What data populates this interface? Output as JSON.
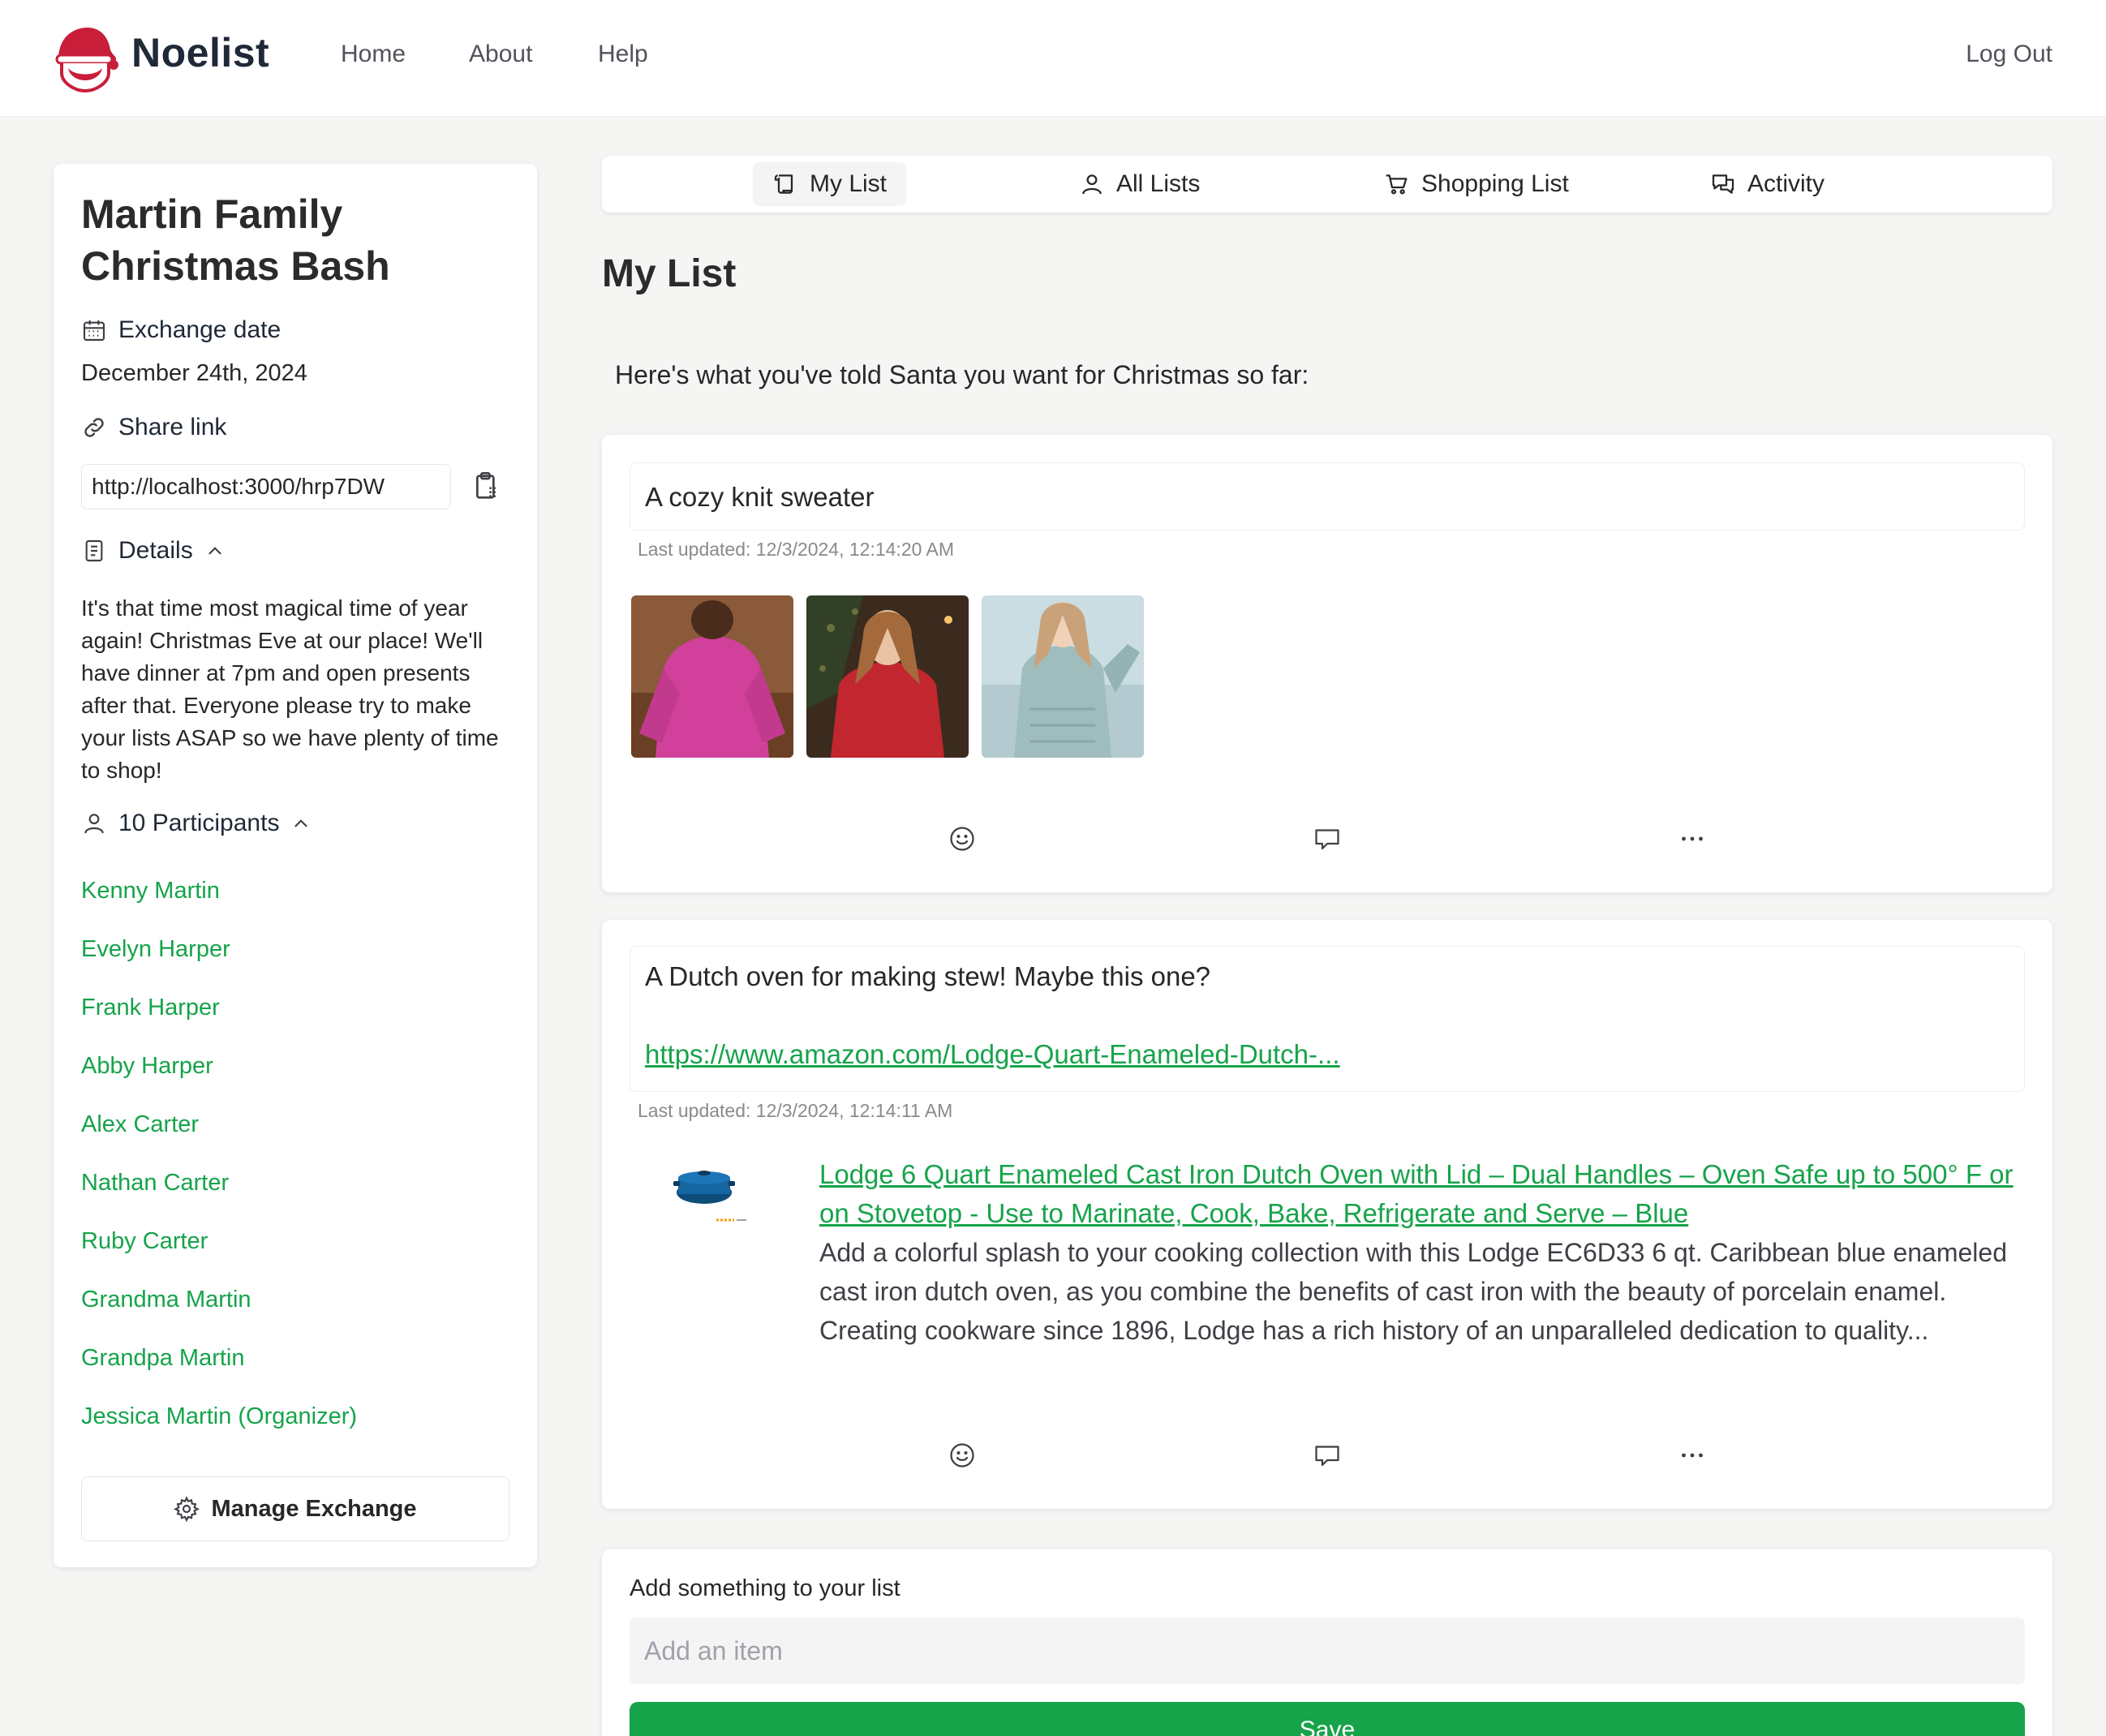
{
  "header": {
    "brand": "Noelist",
    "nav": [
      "Home",
      "About",
      "Help"
    ],
    "logout": "Log Out"
  },
  "sidebar": {
    "title": "Martin Family Christmas Bash",
    "exchange_date_label": "Exchange date",
    "exchange_date": "December 24th, 2024",
    "share_link_label": "Share link",
    "share_link": "http://localhost:3000/hrp7DW",
    "details_label": "Details",
    "details": "It's that time most magical time of year again! Christmas Eve at our place! We'll have dinner at 7pm and open presents after that. Everyone please try to make your lists ASAP so we have plenty of time to shop!",
    "participants_label": "10 Participants",
    "participants": [
      "Kenny Martin",
      "Evelyn Harper",
      "Frank Harper",
      "Abby Harper",
      "Alex Carter",
      "Nathan Carter",
      "Ruby Carter",
      "Grandma Martin",
      "Grandpa Martin",
      "Jessica Martin (Organizer)"
    ],
    "manage_button": "Manage Exchange"
  },
  "tabs": [
    "My List",
    "All Lists",
    "Shopping List",
    "Activity"
  ],
  "main": {
    "title": "My List",
    "intro": "Here's what you've told Santa you want for Christmas so far:",
    "items": [
      {
        "text": "A cozy knit sweater",
        "updated": "Last updated: 12/3/2024, 12:14:20 AM"
      },
      {
        "text": "A Dutch oven for making stew! Maybe this one?",
        "link": "https://www.amazon.com/Lodge-Quart-Enameled-Dutch-...",
        "updated": "Last updated: 12/3/2024, 12:14:11 AM",
        "preview_title": "Lodge 6 Quart Enameled Cast Iron Dutch Oven with Lid – Dual Handles – Oven Safe up to 500° F or on Stovetop - Use to Marinate, Cook, Bake, Refrigerate and Serve – Blue",
        "preview_desc": "Add a colorful splash to your cooking collection with this Lodge EC6D33 6 qt. Caribbean blue enameled cast iron dutch oven, as you combine the benefits of cast iron with the beauty of porcelain enamel. Creating cookware since 1896, Lodge has a rich history of an unparalleled dedication to quality..."
      }
    ],
    "add_label": "Add something to your list",
    "add_placeholder": "Add an item",
    "save_button": "Save"
  },
  "icons": {
    "logo": "santa-logo-icon",
    "calendar": "calendar-icon",
    "link": "link-icon",
    "clipboard": "clipboard-icon",
    "details": "document-icon",
    "chevron": "chevron-up-icon",
    "user": "user-icon",
    "gear": "gear-icon",
    "scroll": "scroll-icon",
    "cart": "cart-icon",
    "chat": "chat-icon",
    "emoji": "emoji-icon",
    "comment": "comment-icon",
    "more": "more-icon"
  },
  "colors": {
    "accent": "#16a34a",
    "brand_red": "#c81e3a",
    "background": "#f5f5f4"
  }
}
